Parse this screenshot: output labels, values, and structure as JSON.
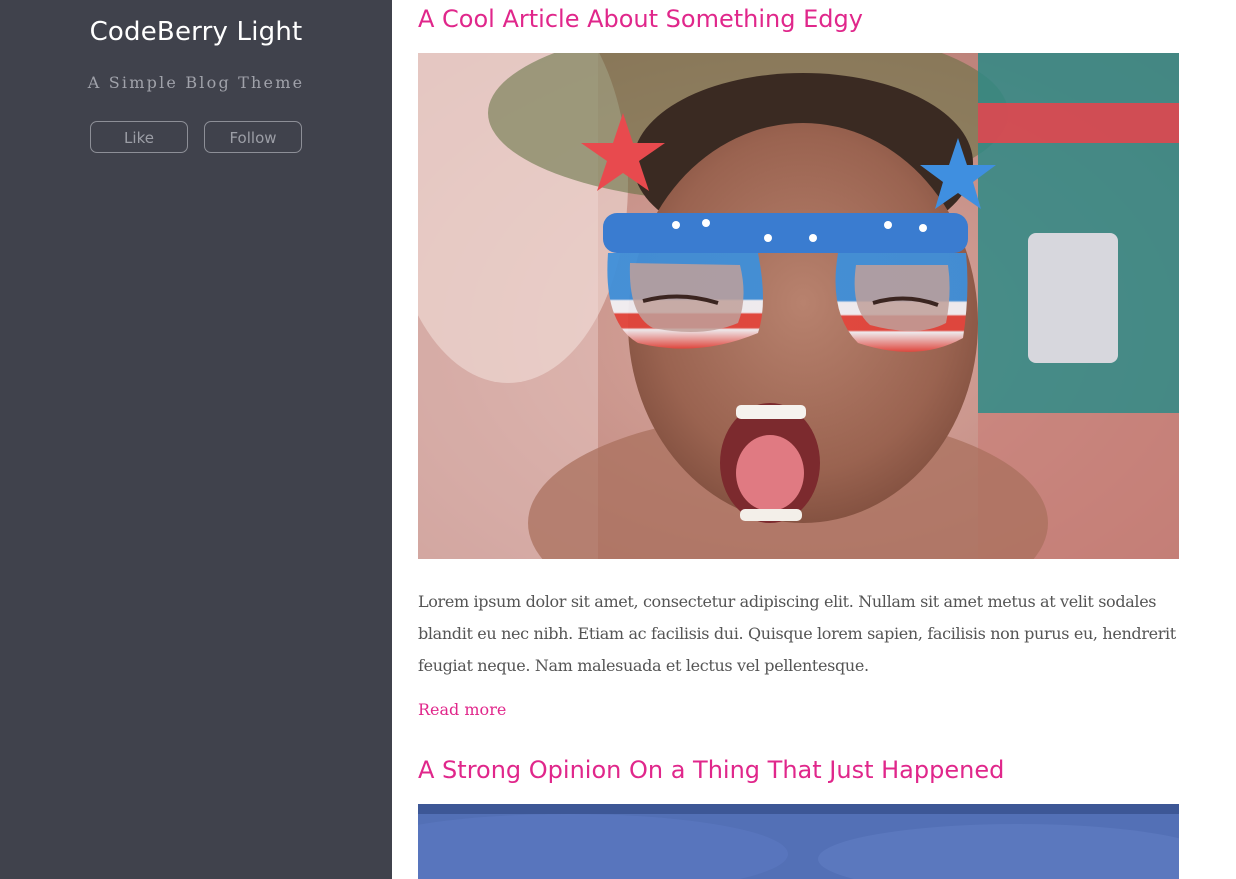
{
  "sidebar": {
    "title": "CodeBerry Light",
    "tagline": "A Simple Blog Theme",
    "like_label": "Like",
    "follow_label": "Follow"
  },
  "posts": [
    {
      "title": "A Cool Article About Something Edgy",
      "image": "child-with-star-glasses-photo",
      "body": "Lorem ipsum dolor sit amet, consectetur adipiscing elit. Nullam sit amet metus at velit sodales blandit eu nec nibh. Etiam ac facilisis dui. Quisque lorem sapien, facilisis non purus eu, hendrerit feugiat neque. Nam malesuada et lectus vel pellentesque.",
      "read_more": "Read more"
    },
    {
      "title": "A Strong Opinion On a Thing That Just Happened",
      "image": "blue-sky-photo"
    }
  ],
  "colors": {
    "sidebar_bg": "#40424c",
    "accent": "#e0278b",
    "body_text": "#555555"
  }
}
